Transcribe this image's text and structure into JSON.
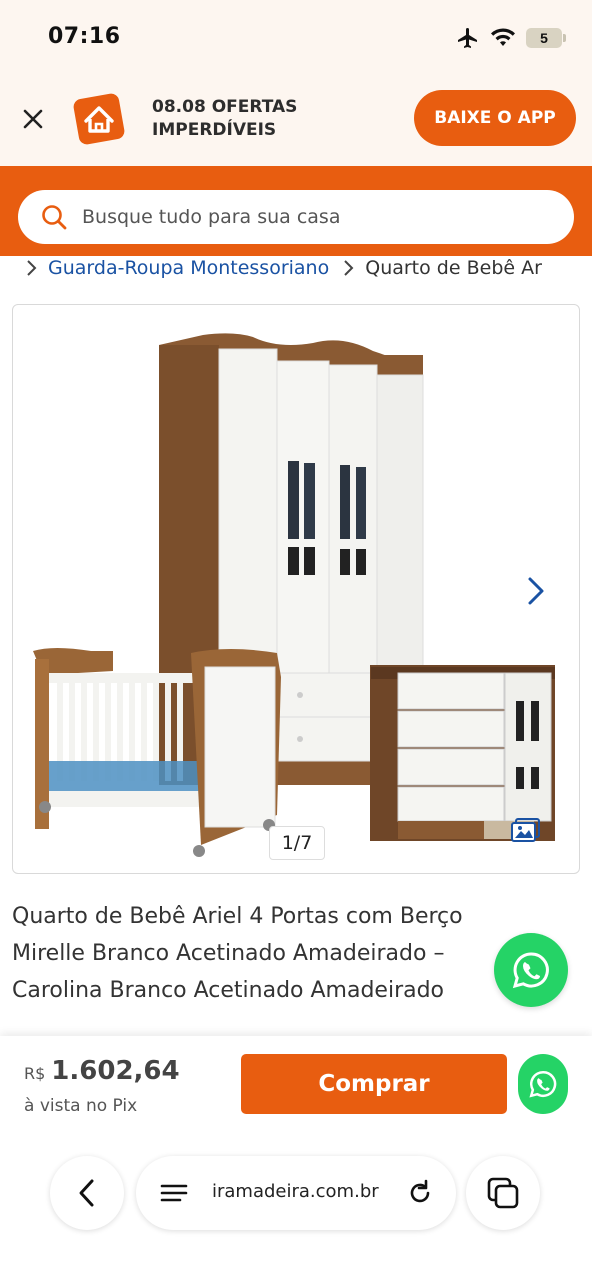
{
  "status_bar": {
    "time": "07:16",
    "battery": "5"
  },
  "app_banner": {
    "title_line1": "08.08 OFERTAS",
    "title_line2": "IMPERDÍVEIS",
    "download_label": "BAIXE O APP"
  },
  "search": {
    "placeholder": "Busque tudo para sua casa"
  },
  "breadcrumb": {
    "items": [
      "Guarda-Roupa Montessoriano",
      "Quarto de Bebê Ar"
    ]
  },
  "gallery": {
    "counter": "1/7"
  },
  "product": {
    "title": "Quarto de Bebê Ariel 4 Portas com Berço Mirelle Branco Acetinado Amadeirado – Carolina Branco Acetinado Amadeirado",
    "currency": "R$",
    "price": "1.602,64",
    "price_note": "à vista no Pix",
    "buy_label": "Comprar"
  },
  "browser": {
    "url": "iramadeira.com.br"
  },
  "colors": {
    "brand_orange": "#e85d10",
    "whatsapp_green": "#25d366",
    "link_blue": "#1a52a3"
  }
}
